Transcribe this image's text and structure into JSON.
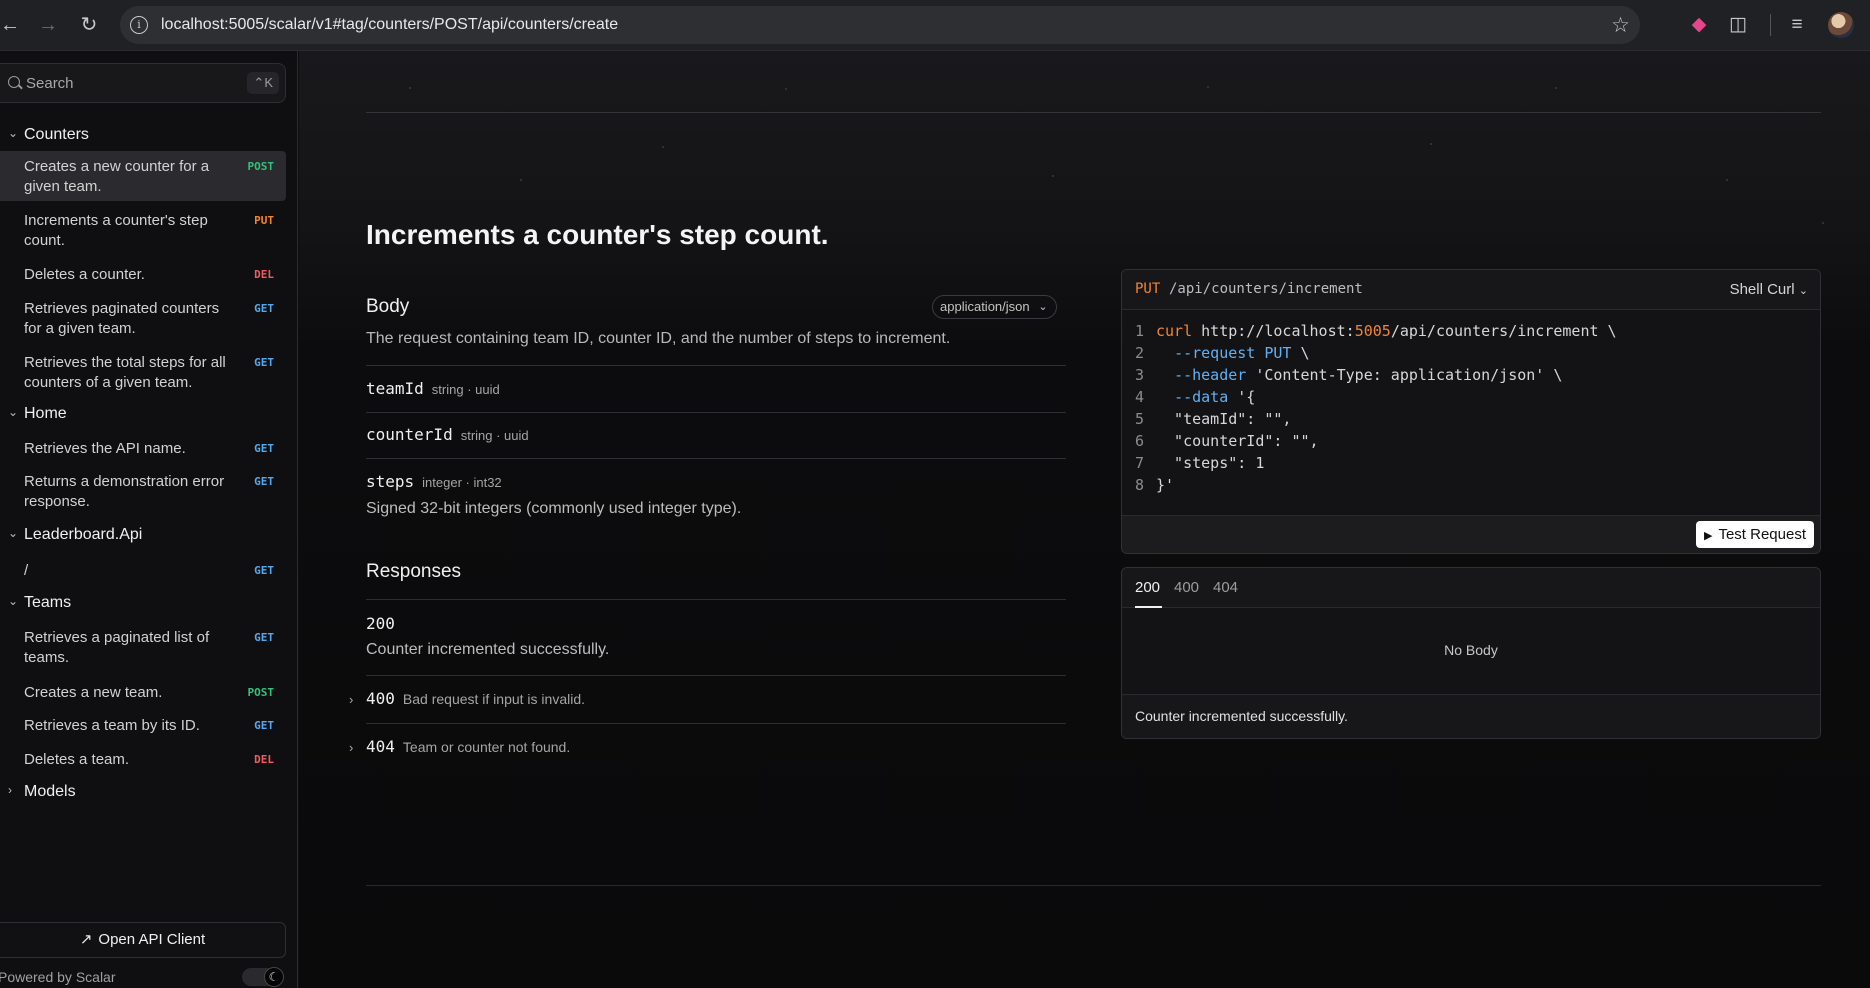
{
  "browser": {
    "url": "localhost:5005/scalar/v1#tag/counters/POST/api/counters/create"
  },
  "sidebar": {
    "search_placeholder": "Search",
    "search_shortcut": "⌃K",
    "groups": [
      {
        "title": "Counters",
        "items": [
          {
            "label": "Creates a new counter for a given team.",
            "method": "POST",
            "active": true
          },
          {
            "label": "Increments a counter's step count.",
            "method": "PUT"
          },
          {
            "label": "Deletes a counter.",
            "method": "DEL"
          },
          {
            "label": "Retrieves paginated counters for a given team.",
            "method": "GET"
          },
          {
            "label": "Retrieves the total steps for all counters of a given team.",
            "method": "GET"
          }
        ]
      },
      {
        "title": "Home",
        "items": [
          {
            "label": "Retrieves the API name.",
            "method": "GET"
          },
          {
            "label": "Returns a demonstration error response.",
            "method": "GET"
          }
        ]
      },
      {
        "title": "Leaderboard.Api",
        "items": [
          {
            "label": "/",
            "method": "GET"
          }
        ]
      },
      {
        "title": "Teams",
        "items": [
          {
            "label": "Retrieves a paginated list of teams.",
            "method": "GET"
          },
          {
            "label": "Creates a new team.",
            "method": "POST"
          },
          {
            "label": "Retrieves a team by its ID.",
            "method": "GET"
          },
          {
            "label": "Deletes a team.",
            "method": "DEL"
          }
        ]
      },
      {
        "title": "Models",
        "items": []
      }
    ],
    "open_client_label": "Open API Client",
    "powered_by": "Powered by Scalar"
  },
  "operation": {
    "title": "Increments a counter's step count.",
    "body_heading": "Body",
    "content_type": "application/json",
    "body_description": "The request containing team ID, counter ID, and the number of steps to increment.",
    "params": [
      {
        "name": "teamId",
        "type": "string · uuid"
      },
      {
        "name": "counterId",
        "type": "string · uuid"
      },
      {
        "name": "steps",
        "type": "integer · int32",
        "description": "Signed 32-bit integers (commonly used integer type)."
      }
    ],
    "responses_heading": "Responses",
    "responses": [
      {
        "code": "200",
        "description": "Counter incremented successfully."
      },
      {
        "code": "400",
        "description": "Bad request if input is invalid."
      },
      {
        "code": "404",
        "description": "Team or counter not found."
      }
    ]
  },
  "request_example": {
    "method": "PUT",
    "path": "/api/counters/increment",
    "language": "Shell Curl",
    "lines": [
      {
        "n": "1",
        "parts": [
          [
            "cmd",
            "curl"
          ],
          [
            "plain",
            " http://localhost:"
          ],
          [
            "kw",
            "5005"
          ],
          [
            "plain",
            "/api/counters/increment \\"
          ]
        ]
      },
      {
        "n": "2",
        "parts": [
          [
            "plain",
            "  "
          ],
          [
            "flag",
            "--request"
          ],
          [
            "plain",
            " "
          ],
          [
            "flag",
            "PUT"
          ],
          [
            "plain",
            " \\"
          ]
        ]
      },
      {
        "n": "3",
        "parts": [
          [
            "plain",
            "  "
          ],
          [
            "flag",
            "--header"
          ],
          [
            "plain",
            " 'Content-Type: application/json' \\"
          ]
        ]
      },
      {
        "n": "4",
        "parts": [
          [
            "plain",
            "  "
          ],
          [
            "flag",
            "--data"
          ],
          [
            "plain",
            " '{"
          ]
        ]
      },
      {
        "n": "5",
        "parts": [
          [
            "plain",
            "  \"teamId\": \"\","
          ]
        ]
      },
      {
        "n": "6",
        "parts": [
          [
            "plain",
            "  \"counterId\": \"\","
          ]
        ]
      },
      {
        "n": "7",
        "parts": [
          [
            "plain",
            "  \"steps\": 1"
          ]
        ]
      },
      {
        "n": "8",
        "parts": [
          [
            "plain",
            "}'"
          ]
        ]
      }
    ],
    "test_button_label": "Test Request"
  },
  "response_example": {
    "tabs": [
      "200",
      "400",
      "404"
    ],
    "selected_tab": "200",
    "body_text": "No Body",
    "footer_text": "Counter incremented successfully."
  }
}
